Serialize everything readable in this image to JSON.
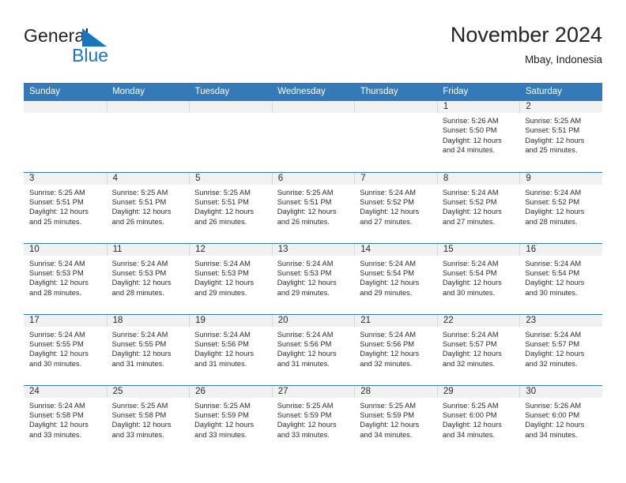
{
  "brand": {
    "name_part1": "General",
    "name_part2": "Blue",
    "triangle_color": "#1b75bb",
    "text_color": "#231f20"
  },
  "header": {
    "title": "November 2024",
    "location": "Mbay, Indonesia"
  },
  "theme": {
    "header_bar": "#3479b8",
    "daynum_strip": "#f1f1f1",
    "row_rule": "#3479b8",
    "text": "#2b2b2b"
  },
  "weekdays": [
    "Sunday",
    "Monday",
    "Tuesday",
    "Wednesday",
    "Thursday",
    "Friday",
    "Saturday"
  ],
  "labels": {
    "sunrise_prefix": "Sunrise:",
    "sunset_prefix": "Sunset:",
    "daylight_prefix": "Daylight:"
  },
  "weeks": [
    [
      {
        "day": "",
        "empty": true
      },
      {
        "day": "",
        "empty": true
      },
      {
        "day": "",
        "empty": true
      },
      {
        "day": "",
        "empty": true
      },
      {
        "day": "",
        "empty": true
      },
      {
        "day": "1",
        "sunrise": "Sunrise: 5:26 AM",
        "sunset": "Sunset: 5:50 PM",
        "daylight_l1": "Daylight: 12 hours",
        "daylight_l2": "and 24 minutes."
      },
      {
        "day": "2",
        "sunrise": "Sunrise: 5:25 AM",
        "sunset": "Sunset: 5:51 PM",
        "daylight_l1": "Daylight: 12 hours",
        "daylight_l2": "and 25 minutes."
      }
    ],
    [
      {
        "day": "3",
        "sunrise": "Sunrise: 5:25 AM",
        "sunset": "Sunset: 5:51 PM",
        "daylight_l1": "Daylight: 12 hours",
        "daylight_l2": "and 25 minutes."
      },
      {
        "day": "4",
        "sunrise": "Sunrise: 5:25 AM",
        "sunset": "Sunset: 5:51 PM",
        "daylight_l1": "Daylight: 12 hours",
        "daylight_l2": "and 26 minutes."
      },
      {
        "day": "5",
        "sunrise": "Sunrise: 5:25 AM",
        "sunset": "Sunset: 5:51 PM",
        "daylight_l1": "Daylight: 12 hours",
        "daylight_l2": "and 26 minutes."
      },
      {
        "day": "6",
        "sunrise": "Sunrise: 5:25 AM",
        "sunset": "Sunset: 5:51 PM",
        "daylight_l1": "Daylight: 12 hours",
        "daylight_l2": "and 26 minutes."
      },
      {
        "day": "7",
        "sunrise": "Sunrise: 5:24 AM",
        "sunset": "Sunset: 5:52 PM",
        "daylight_l1": "Daylight: 12 hours",
        "daylight_l2": "and 27 minutes."
      },
      {
        "day": "8",
        "sunrise": "Sunrise: 5:24 AM",
        "sunset": "Sunset: 5:52 PM",
        "daylight_l1": "Daylight: 12 hours",
        "daylight_l2": "and 27 minutes."
      },
      {
        "day": "9",
        "sunrise": "Sunrise: 5:24 AM",
        "sunset": "Sunset: 5:52 PM",
        "daylight_l1": "Daylight: 12 hours",
        "daylight_l2": "and 28 minutes."
      }
    ],
    [
      {
        "day": "10",
        "sunrise": "Sunrise: 5:24 AM",
        "sunset": "Sunset: 5:53 PM",
        "daylight_l1": "Daylight: 12 hours",
        "daylight_l2": "and 28 minutes."
      },
      {
        "day": "11",
        "sunrise": "Sunrise: 5:24 AM",
        "sunset": "Sunset: 5:53 PM",
        "daylight_l1": "Daylight: 12 hours",
        "daylight_l2": "and 28 minutes."
      },
      {
        "day": "12",
        "sunrise": "Sunrise: 5:24 AM",
        "sunset": "Sunset: 5:53 PM",
        "daylight_l1": "Daylight: 12 hours",
        "daylight_l2": "and 29 minutes."
      },
      {
        "day": "13",
        "sunrise": "Sunrise: 5:24 AM",
        "sunset": "Sunset: 5:53 PM",
        "daylight_l1": "Daylight: 12 hours",
        "daylight_l2": "and 29 minutes."
      },
      {
        "day": "14",
        "sunrise": "Sunrise: 5:24 AM",
        "sunset": "Sunset: 5:54 PM",
        "daylight_l1": "Daylight: 12 hours",
        "daylight_l2": "and 29 minutes."
      },
      {
        "day": "15",
        "sunrise": "Sunrise: 5:24 AM",
        "sunset": "Sunset: 5:54 PM",
        "daylight_l1": "Daylight: 12 hours",
        "daylight_l2": "and 30 minutes."
      },
      {
        "day": "16",
        "sunrise": "Sunrise: 5:24 AM",
        "sunset": "Sunset: 5:54 PM",
        "daylight_l1": "Daylight: 12 hours",
        "daylight_l2": "and 30 minutes."
      }
    ],
    [
      {
        "day": "17",
        "sunrise": "Sunrise: 5:24 AM",
        "sunset": "Sunset: 5:55 PM",
        "daylight_l1": "Daylight: 12 hours",
        "daylight_l2": "and 30 minutes."
      },
      {
        "day": "18",
        "sunrise": "Sunrise: 5:24 AM",
        "sunset": "Sunset: 5:55 PM",
        "daylight_l1": "Daylight: 12 hours",
        "daylight_l2": "and 31 minutes."
      },
      {
        "day": "19",
        "sunrise": "Sunrise: 5:24 AM",
        "sunset": "Sunset: 5:56 PM",
        "daylight_l1": "Daylight: 12 hours",
        "daylight_l2": "and 31 minutes."
      },
      {
        "day": "20",
        "sunrise": "Sunrise: 5:24 AM",
        "sunset": "Sunset: 5:56 PM",
        "daylight_l1": "Daylight: 12 hours",
        "daylight_l2": "and 31 minutes."
      },
      {
        "day": "21",
        "sunrise": "Sunrise: 5:24 AM",
        "sunset": "Sunset: 5:56 PM",
        "daylight_l1": "Daylight: 12 hours",
        "daylight_l2": "and 32 minutes."
      },
      {
        "day": "22",
        "sunrise": "Sunrise: 5:24 AM",
        "sunset": "Sunset: 5:57 PM",
        "daylight_l1": "Daylight: 12 hours",
        "daylight_l2": "and 32 minutes."
      },
      {
        "day": "23",
        "sunrise": "Sunrise: 5:24 AM",
        "sunset": "Sunset: 5:57 PM",
        "daylight_l1": "Daylight: 12 hours",
        "daylight_l2": "and 32 minutes."
      }
    ],
    [
      {
        "day": "24",
        "sunrise": "Sunrise: 5:24 AM",
        "sunset": "Sunset: 5:58 PM",
        "daylight_l1": "Daylight: 12 hours",
        "daylight_l2": "and 33 minutes."
      },
      {
        "day": "25",
        "sunrise": "Sunrise: 5:25 AM",
        "sunset": "Sunset: 5:58 PM",
        "daylight_l1": "Daylight: 12 hours",
        "daylight_l2": "and 33 minutes."
      },
      {
        "day": "26",
        "sunrise": "Sunrise: 5:25 AM",
        "sunset": "Sunset: 5:59 PM",
        "daylight_l1": "Daylight: 12 hours",
        "daylight_l2": "and 33 minutes."
      },
      {
        "day": "27",
        "sunrise": "Sunrise: 5:25 AM",
        "sunset": "Sunset: 5:59 PM",
        "daylight_l1": "Daylight: 12 hours",
        "daylight_l2": "and 33 minutes."
      },
      {
        "day": "28",
        "sunrise": "Sunrise: 5:25 AM",
        "sunset": "Sunset: 5:59 PM",
        "daylight_l1": "Daylight: 12 hours",
        "daylight_l2": "and 34 minutes."
      },
      {
        "day": "29",
        "sunrise": "Sunrise: 5:25 AM",
        "sunset": "Sunset: 6:00 PM",
        "daylight_l1": "Daylight: 12 hours",
        "daylight_l2": "and 34 minutes."
      },
      {
        "day": "30",
        "sunrise": "Sunrise: 5:26 AM",
        "sunset": "Sunset: 6:00 PM",
        "daylight_l1": "Daylight: 12 hours",
        "daylight_l2": "and 34 minutes."
      }
    ]
  ]
}
